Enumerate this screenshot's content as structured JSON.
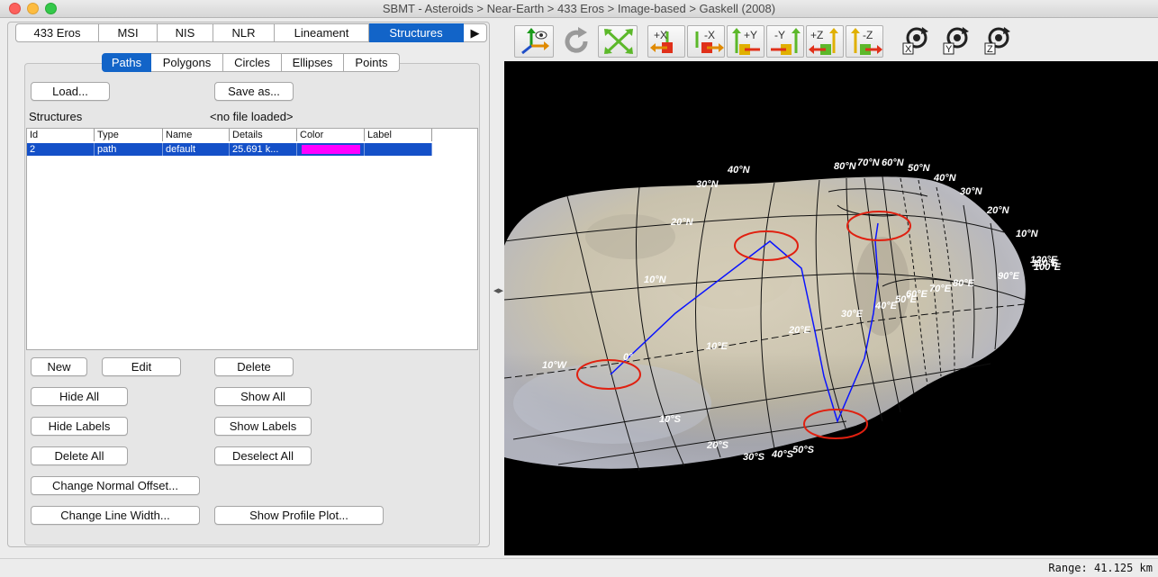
{
  "window": {
    "title": "SBMT - Asteroids > Near-Earth > 433 Eros > Image-based > Gaskell (2008)"
  },
  "top_tabs": [
    "433 Eros",
    "MSI",
    "NIS",
    "NLR",
    "Lineament",
    "Structures",
    "▶"
  ],
  "sub_tabs": [
    "Paths",
    "Polygons",
    "Circles",
    "Ellipses",
    "Points"
  ],
  "file": {
    "load_label": "Load...",
    "save_label": "Save as...",
    "structures_label": "Structures",
    "file_status": "<no file loaded>"
  },
  "table": {
    "columns": [
      "Id",
      "Type",
      "Name",
      "Details",
      "Color",
      "Label"
    ],
    "rows": [
      {
        "id": "2",
        "type": "path",
        "name": "default",
        "details": "25.691 k...",
        "color": "#ff00ff",
        "label": ""
      }
    ]
  },
  "buttons": {
    "new": "New",
    "edit": "Edit",
    "delete": "Delete",
    "hide_all": "Hide All",
    "show_all": "Show All",
    "hide_labels": "Hide Labels",
    "show_labels": "Show Labels",
    "delete_all": "Delete All",
    "deselect_all": "Deselect All",
    "change_normal_offset": "Change Normal Offset...",
    "change_line_width": "Change Line Width...",
    "show_profile_plot": "Show Profile Plot..."
  },
  "toolbar": {
    "view_buttons": [
      "+X",
      "-X",
      "+Y",
      "-Y",
      "+Z",
      "-Z"
    ],
    "rotate_labels": [
      "X",
      "Y",
      "Z"
    ]
  },
  "grid_labels": {
    "latitudes_north": [
      "40°N",
      "30°N",
      "20°N",
      "10°N",
      "80°N",
      "70°N",
      "60°N",
      "50°N",
      "40°N",
      "30°N",
      "20°N",
      "10°N"
    ],
    "latitudes_south": [
      "10°S",
      "20°S",
      "30°S",
      "40°S",
      "50°S"
    ],
    "longitudes": [
      "10°W",
      "0°",
      "10°E",
      "20°E",
      "30°E",
      "40°E",
      "50°E",
      "60°E",
      "70°E",
      "80°E",
      "90°E",
      "100°E",
      "110°E",
      "120°E",
      "130°E"
    ]
  },
  "status": {
    "range": "Range:  41.125 km"
  },
  "colors": {
    "accent": "#1264c8",
    "selection": "#1450c8",
    "path": "#0000ff",
    "marker": "#e02010"
  }
}
